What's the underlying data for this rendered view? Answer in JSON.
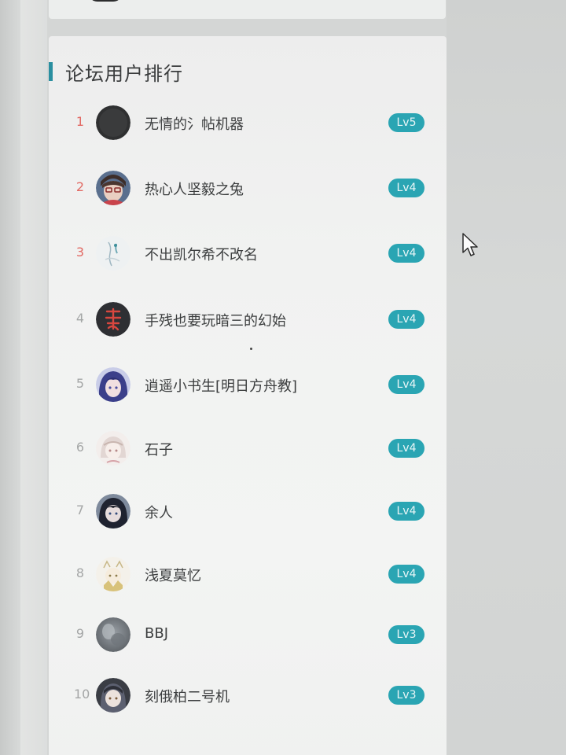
{
  "panel": {
    "title": "论坛用户排行"
  },
  "users": [
    {
      "rank": "1",
      "name": "无情的氵帖机器",
      "level": "Lv5",
      "top": true,
      "avatar": "avatar-dark"
    },
    {
      "rank": "2",
      "name": "热心人坚毅之兔",
      "level": "Lv4",
      "top": true,
      "avatar": "avatar-anime-blue"
    },
    {
      "rank": "3",
      "name": "不出凯尔希不改名",
      "level": "Lv4",
      "top": true,
      "avatar": "avatar-light-sketch"
    },
    {
      "rank": "4",
      "name": "手残也要玩暗三的幻始",
      "level": "Lv4",
      "top": false,
      "avatar": "avatar-red-seal"
    },
    {
      "rank": "5",
      "name": "逍遥小书生[明日方舟教]",
      "level": "Lv4",
      "top": false,
      "avatar": "avatar-anime-purple"
    },
    {
      "rank": "6",
      "name": "石子",
      "level": "Lv4",
      "top": false,
      "avatar": "avatar-anime-white"
    },
    {
      "rank": "7",
      "name": "余人",
      "level": "Lv4",
      "top": false,
      "avatar": "avatar-anime-dark"
    },
    {
      "rank": "8",
      "name": "浅夏莫忆",
      "level": "Lv4",
      "top": false,
      "avatar": "avatar-anime-gold"
    },
    {
      "rank": "9",
      "name": "BBJ",
      "level": "Lv3",
      "top": false,
      "avatar": "avatar-grey-blur"
    },
    {
      "rank": "10",
      "name": "刻俄柏二号机",
      "level": "Lv3",
      "top": false,
      "avatar": "avatar-anime-hood"
    }
  ],
  "colors": {
    "accent": "#2a8fa0",
    "badge": "#2aa5b3",
    "top_rank": "#e26a64",
    "rank": "#a4a6a6"
  },
  "icons": {
    "cursor": "mouse-pointer-icon"
  }
}
